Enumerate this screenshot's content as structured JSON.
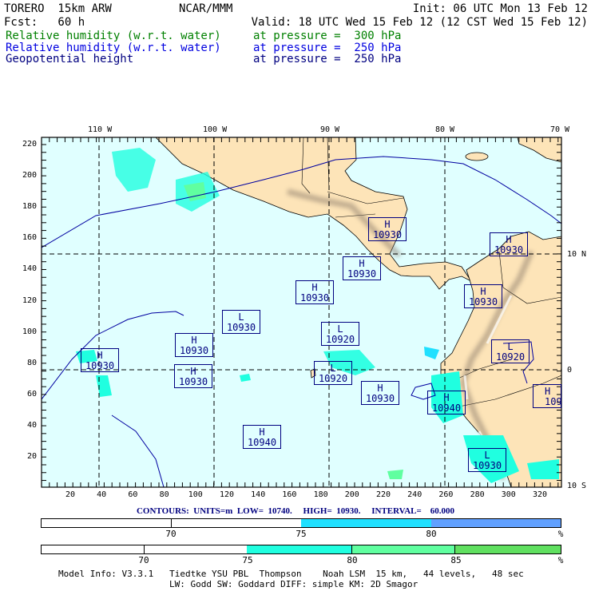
{
  "header": {
    "model": "TORERO  15km ARW",
    "org": "NCAR/MMM",
    "init": "Init: 06 UTC Mon 13 Feb 12",
    "fcst": "Fcst:   60 h",
    "valid": "Valid: 18 UTC Wed 15 Feb 12 (12 CST Wed 15 Feb 12)",
    "fields": [
      {
        "name": "Relative humidity (w.r.t. water)",
        "level": "at pressure =  300 hPa",
        "color": "#008000"
      },
      {
        "name": "Relative humidity (w.r.t. water)",
        "level": "at pressure =  250 hPa",
        "color": "#0000e0"
      },
      {
        "name": "Geopotential height",
        "level": "at pressure =  250 hPa",
        "color": "#000080"
      }
    ]
  },
  "map": {
    "lon_labels": [
      "110 W",
      "100 W",
      "90 W",
      "80 W",
      "70 W"
    ],
    "lat_labels": [
      "10 N",
      "0",
      "10 S"
    ],
    "y_ticks": [
      "220",
      "200",
      "180",
      "160",
      "140",
      "120",
      "100",
      "80",
      "60",
      "40",
      "20"
    ],
    "x_ticks": [
      "20",
      "40",
      "60",
      "80",
      "100",
      "120",
      "140",
      "160",
      "180",
      "200",
      "220",
      "240",
      "260",
      "280",
      "300",
      "320"
    ],
    "centers": [
      {
        "type": "H",
        "value": "10930"
      },
      {
        "type": "H",
        "value": "10930"
      },
      {
        "type": "H",
        "value": "10930"
      },
      {
        "type": "H",
        "value": "10930"
      },
      {
        "type": "H",
        "value": "10930"
      },
      {
        "type": "L",
        "value": "10930"
      },
      {
        "type": "L",
        "value": "10920"
      },
      {
        "type": "H",
        "value": "10930"
      },
      {
        "type": "L",
        "value": "10920"
      },
      {
        "type": "H",
        "value": "10930"
      },
      {
        "type": "H",
        "value": "10930"
      },
      {
        "type": "L",
        "value": "10920"
      },
      {
        "type": "H",
        "value": "10930"
      },
      {
        "type": "H",
        "value": "10940"
      },
      {
        "type": "H",
        "value": "109"
      },
      {
        "type": "H",
        "value": "10940"
      },
      {
        "type": "L",
        "value": "10930"
      }
    ],
    "colors": {
      "ocean": "#e0ffff",
      "land": "#fde4b8",
      "contour": "#0000a0",
      "rh250_1": "#20e0ff",
      "rh250_2": "#60a0ff",
      "rh300_1": "#20ffe0",
      "rh300_2": "#60ffa0",
      "rh300_3": "#60e060"
    }
  },
  "contours_info": "CONTOURS:  UNITS=m  LOW=  10740.     HIGH=  10930.     INTERVAL=    60.000",
  "colorbar_250": {
    "labels": [
      "70",
      "75",
      "80",
      "%"
    ]
  },
  "colorbar_300": {
    "labels": [
      "70",
      "75",
      "80",
      "85",
      "%"
    ]
  },
  "model_info": {
    "line1": "Model Info: V3.3.1   Tiedtke YSU PBL  Thompson    Noah LSM  15 km,   44 levels,   48 sec",
    "line2": "LW: Godd SW: Goddard DIFF: simple KM: 2D Smagor"
  }
}
